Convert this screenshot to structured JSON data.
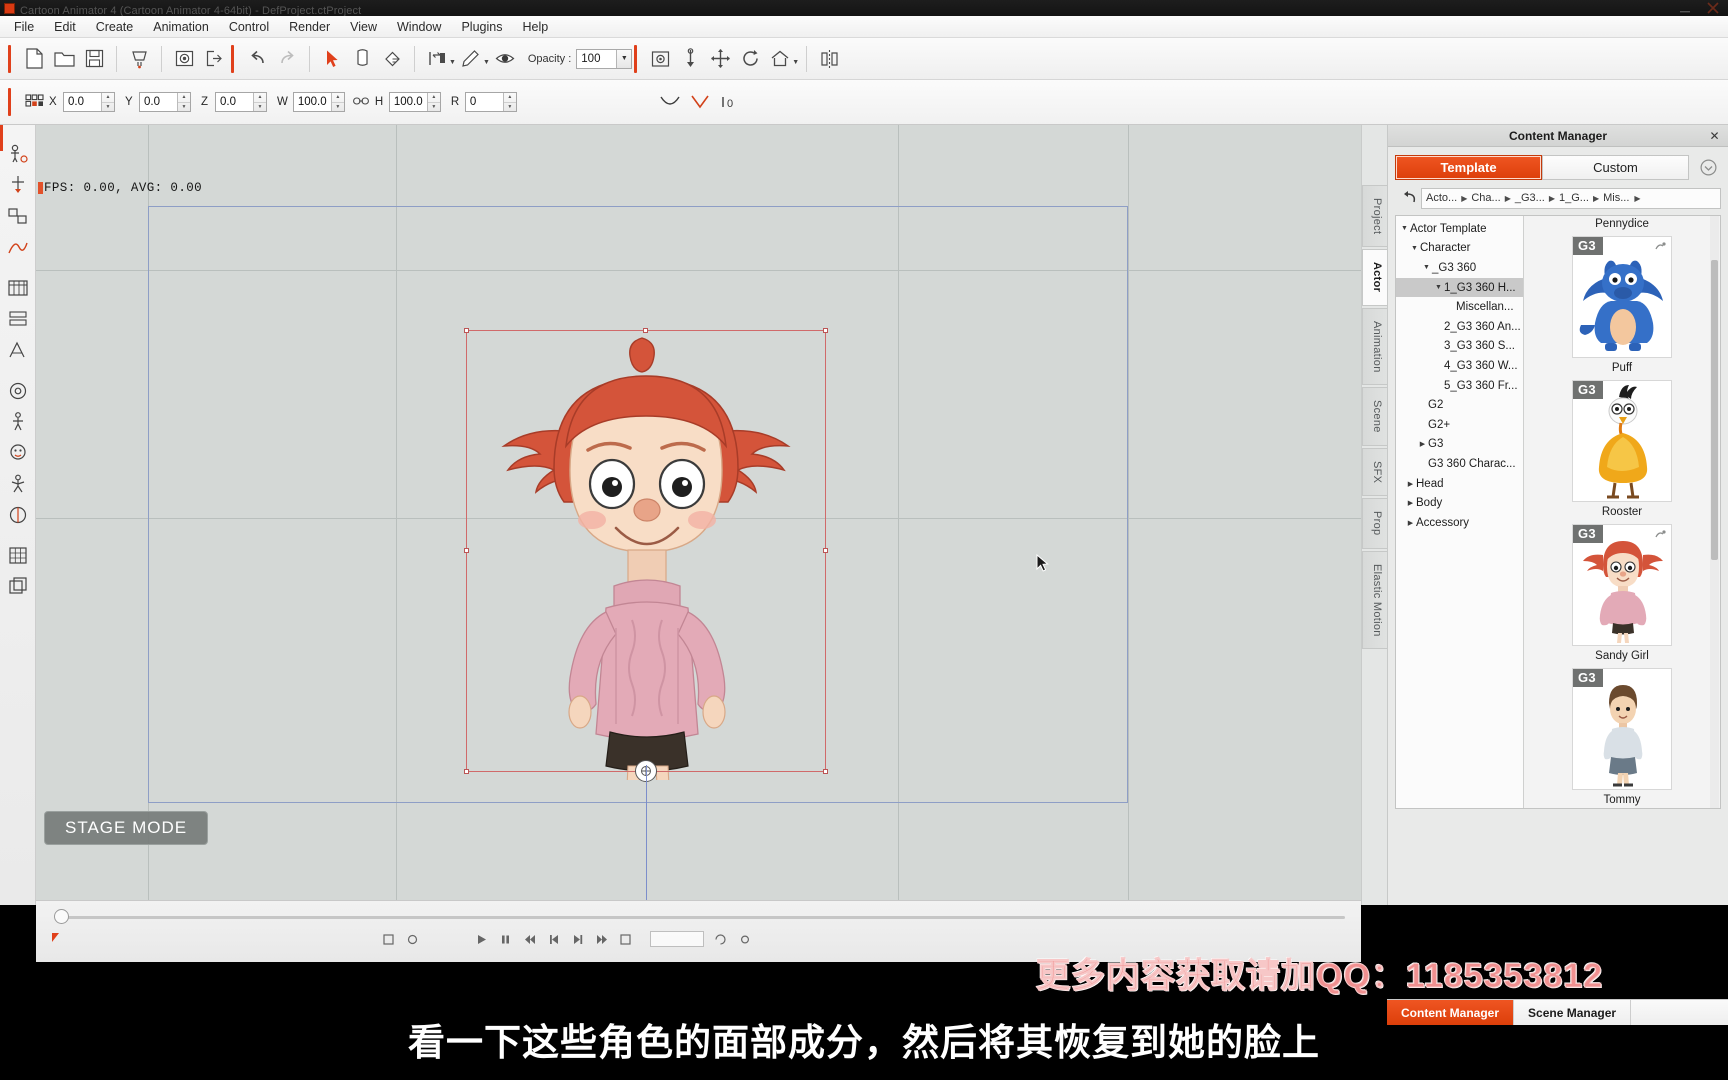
{
  "window": {
    "title": "Cartoon Animator 4  (Cartoon Animator 4-64bit) - DefProject.ctProject",
    "app_icon": "app-icon",
    "minimize": "minimize-icon",
    "close": "close-icon"
  },
  "menubar": {
    "items": [
      {
        "label": "File"
      },
      {
        "label": "Edit"
      },
      {
        "label": "Create"
      },
      {
        "label": "Animation"
      },
      {
        "label": "Control"
      },
      {
        "label": "Render"
      },
      {
        "label": "View"
      },
      {
        "label": "Window"
      },
      {
        "label": "Plugins"
      },
      {
        "label": "Help"
      }
    ]
  },
  "toolbar": {
    "opacity_label": "Opacity :",
    "opacity_value": "100",
    "buttons": [
      {
        "name": "new-project-icon",
        "title": "New"
      },
      {
        "name": "open-project-icon",
        "title": "Open"
      },
      {
        "name": "save-project-icon",
        "title": "Save"
      },
      {
        "name": "content-store-icon",
        "title": "Content Store"
      },
      {
        "name": "import-icon",
        "title": "Import"
      },
      {
        "name": "export-icon",
        "title": "Export"
      },
      {
        "name": "undo-icon",
        "title": "Undo"
      },
      {
        "name": "redo-icon",
        "title": "Redo"
      },
      {
        "name": "select-arrow-icon",
        "title": "Select"
      },
      {
        "name": "transform-icon",
        "title": "Transform"
      },
      {
        "name": "paint-bucket-icon",
        "title": "Fill"
      },
      {
        "name": "align-icon",
        "title": "Align"
      },
      {
        "name": "pen-icon",
        "title": "Pen"
      },
      {
        "name": "eye-icon",
        "title": "Visibility"
      },
      {
        "name": "sprite-editor-icon",
        "title": "Sprite Editor"
      },
      {
        "name": "pin-icon",
        "title": "Pin"
      },
      {
        "name": "move-icon",
        "title": "Move"
      },
      {
        "name": "rotate-icon",
        "title": "Rotate"
      },
      {
        "name": "home-icon",
        "title": "Home"
      },
      {
        "name": "mirror-icon",
        "title": "Mirror"
      }
    ]
  },
  "propbar": {
    "grid_icon": "grid-icon",
    "fields": [
      {
        "label": "X",
        "value": "0.0"
      },
      {
        "label": "Y",
        "value": "0.0"
      },
      {
        "label": "Z",
        "value": "0.0"
      },
      {
        "label": "W",
        "value": "100.0"
      },
      {
        "label": "H",
        "value": "100.0"
      },
      {
        "label": "R",
        "value": "0"
      }
    ],
    "link_icon": "link-icon",
    "extra_icons": [
      "curve-icon",
      "angle-icon",
      "baseline-icon"
    ],
    "baseline_value": "0"
  },
  "left_rail": {
    "items": [
      {
        "name": "rail-body-puppet"
      },
      {
        "name": "rail-face-puppet"
      },
      {
        "name": "rail-sprite-editor"
      },
      {
        "name": "rail-motion-curve"
      },
      {
        "name": "rail-timeline"
      },
      {
        "name": "rail-layer-manager"
      },
      {
        "name": "rail-transform"
      },
      {
        "name": "rail-render-setting"
      },
      {
        "name": "rail-bone-editor"
      },
      {
        "name": "rail-face-key"
      },
      {
        "name": "rail-motion-puppet"
      },
      {
        "name": "rail-elastic"
      },
      {
        "name": "rail-grid"
      },
      {
        "name": "rail-layers"
      }
    ]
  },
  "stage": {
    "fps_text": "FPS: 0.00, AVG: 0.00",
    "mode_badge": "STAGE MODE",
    "cursor": "mouse-pointer"
  },
  "right_tabs": {
    "items": [
      {
        "label": "Project",
        "active": false
      },
      {
        "label": "Actor",
        "active": true
      },
      {
        "label": "Animation",
        "active": false
      },
      {
        "label": "Scene",
        "active": false
      },
      {
        "label": "SFX",
        "active": false
      },
      {
        "label": "Prop",
        "active": false
      },
      {
        "label": "Elastic Motion",
        "active": false
      }
    ]
  },
  "content_manager": {
    "title": "Content Manager",
    "close_glyph": "✕",
    "tabs": [
      {
        "label": "Template",
        "active": true
      },
      {
        "label": "Custom",
        "active": false
      }
    ],
    "options_icon": "options-circle-icon",
    "back_icon": "back-arrow-icon",
    "breadcrumbs": [
      "Acto...",
      "Cha...",
      "_G3...",
      "1_G...",
      "Mis..."
    ],
    "breadcrumb_sep": "▶",
    "breadcrumb_more": "▶",
    "tree": [
      {
        "label": "Actor Template",
        "indent": 0,
        "twisty": "down",
        "selected": false
      },
      {
        "label": "Character",
        "indent": 1,
        "twisty": "down",
        "selected": false
      },
      {
        "label": "_G3 360",
        "indent": 2,
        "twisty": "down",
        "selected": false
      },
      {
        "label": "1_G3 360 H...",
        "indent": 3,
        "twisty": "down",
        "selected": true
      },
      {
        "label": "Miscellan...",
        "indent": 4,
        "twisty": "none",
        "selected": false
      },
      {
        "label": "2_G3 360 An...",
        "indent": 3,
        "twisty": "none",
        "selected": false
      },
      {
        "label": "3_G3 360 S...",
        "indent": 3,
        "twisty": "none",
        "selected": false
      },
      {
        "label": "4_G3 360 W...",
        "indent": 3,
        "twisty": "none",
        "selected": false
      },
      {
        "label": "5_G3 360 Fr...",
        "indent": 3,
        "twisty": "none",
        "selected": false
      },
      {
        "label": "G2",
        "indent": 2,
        "twisty": "none",
        "selected": false
      },
      {
        "label": "G2+",
        "indent": 2,
        "twisty": "none",
        "selected": false
      },
      {
        "label": "G3",
        "indent": 2,
        "twisty": "right",
        "selected": false
      },
      {
        "label": "G3 360 Charac...",
        "indent": 2,
        "twisty": "none",
        "selected": false
      },
      {
        "label": "Head",
        "indent": 1,
        "twisty": "right",
        "selected": false
      },
      {
        "label": "Body",
        "indent": 1,
        "twisty": "right",
        "selected": false
      },
      {
        "label": "Accessory",
        "indent": 1,
        "twisty": "right",
        "selected": false
      }
    ],
    "grid_items": [
      {
        "label": "Pennydice",
        "badge": "",
        "art": "none",
        "partial_top": true
      },
      {
        "label": "Puff",
        "badge": "G3",
        "art": "dragon"
      },
      {
        "label": "Rooster",
        "badge": "G3",
        "art": "rooster"
      },
      {
        "label": "Sandy Girl",
        "badge": "G3",
        "art": "girl"
      },
      {
        "label": "Tommy",
        "badge": "G3",
        "art": "boy"
      }
    ]
  },
  "dock": {
    "tabs": [
      {
        "label": "Content Manager",
        "active": true
      },
      {
        "label": "Scene Manager",
        "active": false
      }
    ]
  },
  "timeline": {
    "controls": [
      "play-icon",
      "stop-icon",
      "prev-frame-icon",
      "rewind-icon",
      "forward-icon",
      "next-frame-icon",
      "end-icon",
      "loop-icon"
    ],
    "field_value": ""
  },
  "overlays": {
    "watermark": "更多内容获取请加QQ：1185353812",
    "subtitle": "看一下这些角色的面部成分，然后将其恢复到她的脸上"
  },
  "colors": {
    "accent": "#e0401b",
    "accent_active": "#ef5522",
    "stage_bg": "#d4d8d6",
    "panel_bg": "#e9eae9",
    "selection": "#d06a6a",
    "watermark": "#f09090"
  }
}
